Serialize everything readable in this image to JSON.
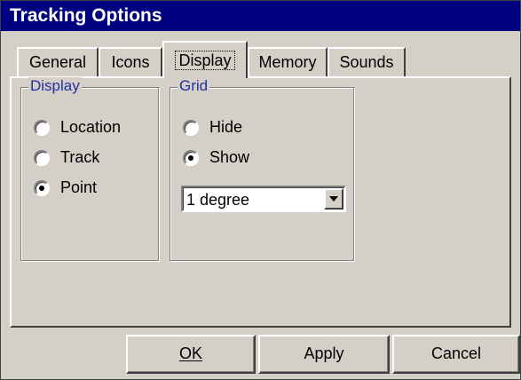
{
  "window": {
    "title": "Tracking Options"
  },
  "tabs": [
    {
      "label": "General"
    },
    {
      "label": "Icons"
    },
    {
      "label": "Display",
      "active": true
    },
    {
      "label": "Memory"
    },
    {
      "label": "Sounds"
    }
  ],
  "display_group": {
    "legend": "Display",
    "options": [
      {
        "label": "Location",
        "checked": false
      },
      {
        "label": "Track",
        "checked": false
      },
      {
        "label": "Point",
        "checked": true
      }
    ]
  },
  "grid_group": {
    "legend": "Grid",
    "options": [
      {
        "label": "Hide",
        "checked": false
      },
      {
        "label": "Show",
        "checked": true
      }
    ],
    "spacing_select": {
      "value": "1 degree"
    }
  },
  "buttons": {
    "ok": "OK",
    "apply": "Apply",
    "cancel": "Cancel"
  },
  "colors": {
    "titlebar": "#000080",
    "face": "#d4d0c8",
    "legend_text": "#2030a0"
  }
}
